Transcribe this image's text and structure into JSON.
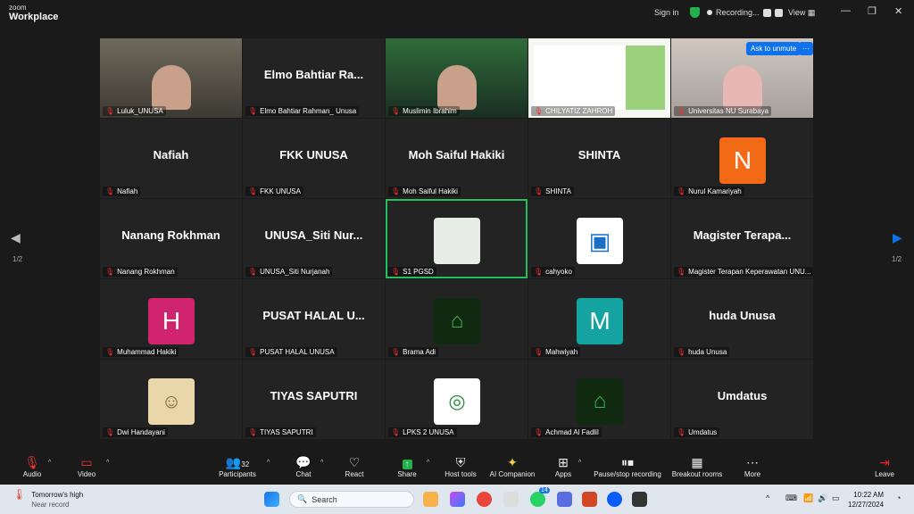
{
  "app": {
    "brand_top": "zoom",
    "brand_bottom": "Workplace"
  },
  "topbar": {
    "sign_in": "Sign in",
    "recording": "Recording...",
    "view": "View",
    "minimize": "—",
    "restore": "❐",
    "close": "✕"
  },
  "unmute": {
    "ask": "Ask to unmute",
    "more": "···"
  },
  "pages": {
    "left": "1/2",
    "right": "1/2"
  },
  "tiles": [
    {
      "big": "",
      "label": "Luluk_UNUSA",
      "kind": "video"
    },
    {
      "big": "Elmo Bahtiar Ra...",
      "label": "Elmo Bahtiar Rahman_ Unusa"
    },
    {
      "big": "",
      "label": "Muslimin Ibrahim",
      "kind": "video"
    },
    {
      "big": "",
      "label": "CHILYATIZ ZAHROH",
      "kind": "slides"
    },
    {
      "big": "",
      "label": "Universitas NU Surabaya",
      "kind": "video"
    },
    {
      "big": "Nafiah",
      "label": "Nafiah"
    },
    {
      "big": "FKK UNUSA",
      "label": "FKK UNUSA"
    },
    {
      "big": "Moh Saiful Hakiki",
      "label": "Moh Saiful Hakiki"
    },
    {
      "big": "SHINTA",
      "label": "SHINTA"
    },
    {
      "big": "",
      "label": "Nurul Kamariyah",
      "avatar": "N",
      "avatar_color": "#f26a16"
    },
    {
      "big": "Nanang Rokhman",
      "label": "Nanang Rokhman"
    },
    {
      "big": "UNUSA_Siti Nur...",
      "label": "UNUSA_Siti Nurjanah"
    },
    {
      "big": "",
      "label": "S1 PGSD",
      "kind": "thumb",
      "active": true
    },
    {
      "big": "",
      "label": "cahyoko",
      "kind": "logo-blue"
    },
    {
      "big": "Magister Terapa...",
      "label": "Magister Terapan Keperawatan UNU..."
    },
    {
      "big": "",
      "label": "Muhammad Hakiki",
      "avatar": "H",
      "avatar_color": "#d0246f"
    },
    {
      "big": "PUSAT HALAL U...",
      "label": "PUSAT HALAL UNUSA"
    },
    {
      "big": "",
      "label": "Brama Adi",
      "kind": "logo-green"
    },
    {
      "big": "",
      "label": "Mahwiyah",
      "avatar": "M",
      "avatar_color": "#14a3a0"
    },
    {
      "big": "huda Unusa",
      "label": "huda Unusa"
    },
    {
      "big": "",
      "label": "Dwi Handayani",
      "kind": "photo"
    },
    {
      "big": "TIYAS SAPUTRI",
      "label": "TIYAS SAPUTRI"
    },
    {
      "big": "",
      "label": "LPKS 2 UNUSA",
      "kind": "logo-white"
    },
    {
      "big": "",
      "label": "Achmad Al Fadlil",
      "kind": "logo-green"
    },
    {
      "big": "Umdatus",
      "label": "Umdatus"
    }
  ],
  "toolbar": {
    "audio": "Audio",
    "video": "Video",
    "participants": "Participants",
    "participants_count": "32",
    "chat": "Chat",
    "react": "React",
    "share": "Share",
    "host_tools": "Host tools",
    "ai_companion": "AI Companion",
    "apps": "Apps",
    "pause_recording": "Pause/stop recording",
    "breakout": "Breakout rooms",
    "more": "More",
    "leave": "Leave"
  },
  "taskbar": {
    "weather_title": "Tomorrow's high",
    "weather_sub": "Near record",
    "search": "Search",
    "badge": "14",
    "time": "10:22 AM",
    "date": "12/27/2024"
  },
  "colors": {
    "accent": "#0e72ed",
    "active_speaker": "#23c15b",
    "leave": "#e02828"
  }
}
